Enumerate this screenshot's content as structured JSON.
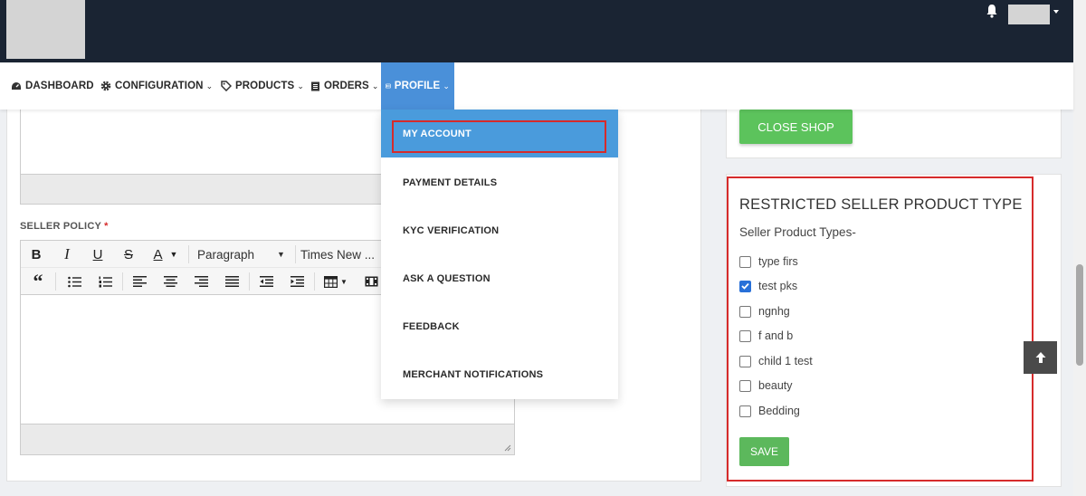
{
  "nav": {
    "items": [
      {
        "label": "DASHBOARD",
        "icon": "dashboard-icon"
      },
      {
        "label": "CONFIGURATION",
        "icon": "gear-icon"
      },
      {
        "label": "PRODUCTS",
        "icon": "tag-icon"
      },
      {
        "label": "ORDERS",
        "icon": "clipboard-icon"
      },
      {
        "label": "PROFILE",
        "icon": "id-card-icon"
      }
    ]
  },
  "profile_menu": {
    "items": [
      "MY ACCOUNT",
      "PAYMENT DETAILS",
      "KYC VERIFICATION",
      "ASK A QUESTION",
      "FEEDBACK",
      "MERCHANT NOTIFICATIONS"
    ]
  },
  "seller_policy": {
    "label": "SELLER POLICY",
    "required_mark": "*",
    "paragraph_select": "Paragraph",
    "font_select": "Times New ..."
  },
  "shop": {
    "close_label": "CLOSE SHOP"
  },
  "restricted": {
    "title": "RESTRICTED SELLER PRODUCT TYPE",
    "subtitle": "Seller Product Types-",
    "types": [
      {
        "label": "type firs",
        "checked": false
      },
      {
        "label": "test pks",
        "checked": true
      },
      {
        "label": "ngnhg",
        "checked": false
      },
      {
        "label": "f and b",
        "checked": false
      },
      {
        "label": "child 1 test",
        "checked": false
      },
      {
        "label": "beauty",
        "checked": false
      },
      {
        "label": "Bedding",
        "checked": false
      }
    ],
    "save_label": "SAVE"
  },
  "colors": {
    "header_bg": "#1a2433",
    "active_nav": "#4a90d9",
    "button_green": "#5cc35c",
    "highlight_red": "#d62b2b",
    "checkbox_blue": "#2870d8"
  }
}
